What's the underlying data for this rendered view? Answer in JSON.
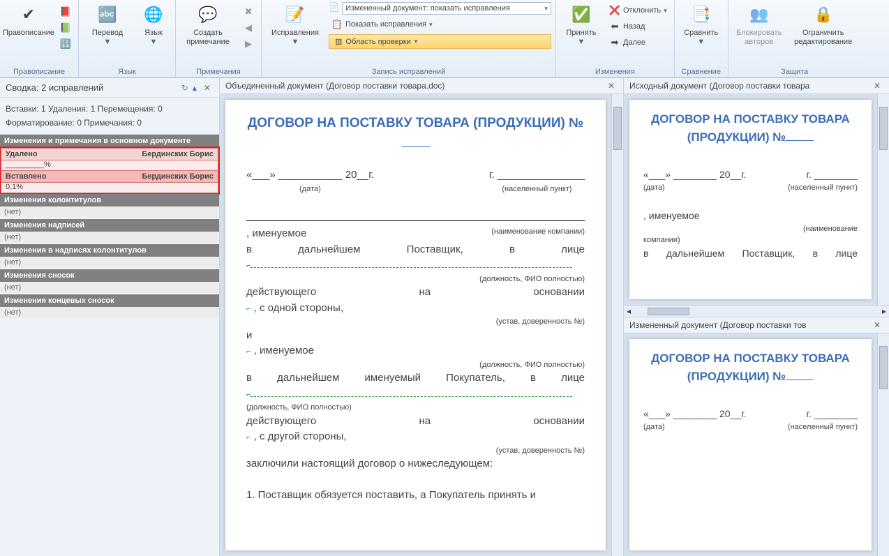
{
  "ribbon": {
    "proofing": {
      "spelling": "Правописание",
      "group": "Правописание"
    },
    "language": {
      "translate": "Перевод",
      "language": "Язык",
      "group": "Язык"
    },
    "comments": {
      "new": "Создать\nпримечание",
      "group": "Примечания"
    },
    "tracking": {
      "track": "Исправления",
      "display_label": "Измененный документ: показать исправления",
      "show_markup": "Показать исправления",
      "reviewing_pane": "Область проверки",
      "group": "Запись исправлений"
    },
    "changes": {
      "accept": "Принять",
      "reject": "Отклонить",
      "previous": "Назад",
      "next": "Далее",
      "group": "Изменения"
    },
    "compare": {
      "compare": "Сравнить",
      "group": "Сравнение"
    },
    "protect": {
      "block": "Блокировать\nавторов",
      "restrict": "Ограничить\nредактирование",
      "group": "Защита"
    }
  },
  "sidepane": {
    "title": "Сводка: 2 исправлений",
    "stats_line1": "Вставки: 1 Удаления: 1 Перемещения: 0",
    "stats_line2": "Форматирование: 0 Примечания: 0",
    "section_main": "Изменения и примечания в основном документе",
    "deleted_label": "Удалено",
    "author": "Бердинских Борис",
    "deleted_value": "_________%",
    "inserted_label": "Вставлено",
    "inserted_value": "0,1%",
    "section_header": "Изменения колонтитулов",
    "none": "(нет)",
    "section_labels": "Изменения надписей",
    "section_header_labels": "Изменения в надписях колонтитулов",
    "section_footnotes": "Изменения сносок",
    "section_endnotes": "Изменения концевых сносок"
  },
  "tabs": {
    "combined": "Объединенный документ (Договор поставки товара.doc)",
    "source": "Исходный документ (Договор поставки товара",
    "revised": "Измененный документ (Договор поставки тов"
  },
  "doc": {
    "title": "ДОГОВОР НА ПОСТАВКУ ТОВАРА (ПРОДУКЦИИ) №",
    "date_left": "«___»",
    "date_year": "20__г.",
    "date_caption": "(дата)",
    "city_caption": "(населенный пункт)",
    "named": ", именуемое",
    "company_caption": "(наименование компании)",
    "supplier_line": "в дальнейшем Поставщик, в лице",
    "position_caption": "(должность, ФИО полностью)",
    "acting_on": "действующего на основании",
    "side1": ", с одной стороны,",
    "charter_caption": "(устав, доверенность №)",
    "and": "и",
    "buyer_line": "в дальнейшем именуемый Покупатель, в лице",
    "side2": ", с другой стороны,",
    "concluded": "заключили настоящий договор о нижеследующем:",
    "clause1": "1. Поставщик обязуется поставить, а Покупатель принять и",
    "g": "г."
  }
}
